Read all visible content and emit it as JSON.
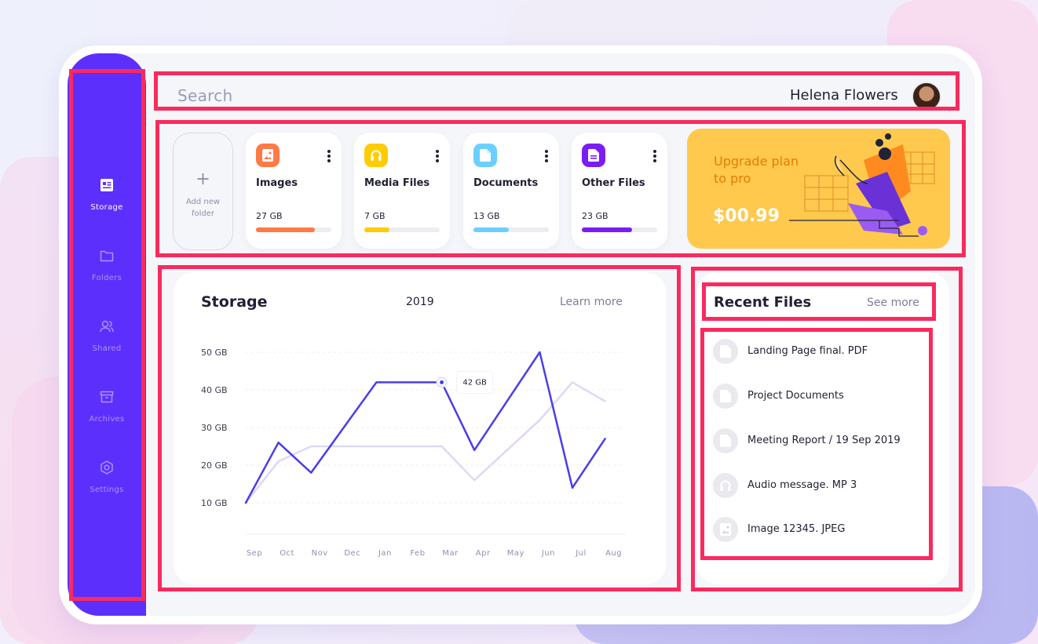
{
  "header": {
    "search_placeholder": "Search",
    "user_name": "Helena Flowers"
  },
  "sidebar": {
    "items": [
      {
        "label": "Storage",
        "icon": "storage-icon",
        "active": true
      },
      {
        "label": "Folders",
        "icon": "folder-icon",
        "active": false
      },
      {
        "label": "Shared",
        "icon": "users-icon",
        "active": false
      },
      {
        "label": "Archives",
        "icon": "archive-icon",
        "active": false
      },
      {
        "label": "Settings",
        "icon": "settings-icon",
        "active": false
      }
    ]
  },
  "folders": {
    "add_label": "Add new folder",
    "cards": [
      {
        "title": "Images",
        "size": "27 GB",
        "icon": "image-icon",
        "color": "#ff7a45",
        "progress": 0.78
      },
      {
        "title": "Media Files",
        "size": "7 GB",
        "icon": "headphones-icon",
        "color": "#ffcc00",
        "progress": 0.33
      },
      {
        "title": "Documents",
        "size": "13 GB",
        "icon": "document-icon",
        "color": "#6bd0ff",
        "progress": 0.47
      },
      {
        "title": "Other Files",
        "size": "23 GB",
        "icon": "file-icon",
        "color": "#7a1df5",
        "progress": 0.67
      }
    ]
  },
  "promo": {
    "title": "Upgrade plan to pro",
    "price": "$00.99"
  },
  "storage": {
    "title": "Storage",
    "year": "2019",
    "learn_more": "Learn more",
    "tooltip": "42 GB"
  },
  "chart_data": {
    "type": "line",
    "categories": [
      "Sep",
      "Oct",
      "Nov",
      "Dec",
      "Jan",
      "Feb",
      "Mar",
      "Apr",
      "May",
      "Jun",
      "Jul",
      "Aug"
    ],
    "yticks": [
      "10 GB",
      "20 GB",
      "30 GB",
      "40 GB",
      "50 GB"
    ],
    "ylim": [
      10,
      50
    ],
    "series": [
      {
        "values": [
          10,
          26,
          18,
          30,
          42,
          42,
          42,
          24,
          37,
          50,
          14,
          27
        ],
        "color": "#4a3dea"
      },
      {
        "values": [
          10,
          21,
          25,
          25,
          25,
          25,
          25,
          16,
          24,
          32,
          42,
          37
        ],
        "color": "#dcd9f7"
      }
    ],
    "highlight": {
      "category": "Mar",
      "value": 42
    },
    "grid": true
  },
  "recent": {
    "title": "Recent Files",
    "see_more": "See more",
    "items": [
      {
        "label": "Landing Page final. PDF",
        "icon": "document-icon"
      },
      {
        "label": "Project Documents",
        "icon": "document-icon"
      },
      {
        "label": "Meeting Report / 19 Sep 2019",
        "icon": "document-icon"
      },
      {
        "label": "Audio message. MP 3",
        "icon": "headphones-icon"
      },
      {
        "label": "Image 12345. JPEG",
        "icon": "image-icon"
      }
    ]
  }
}
